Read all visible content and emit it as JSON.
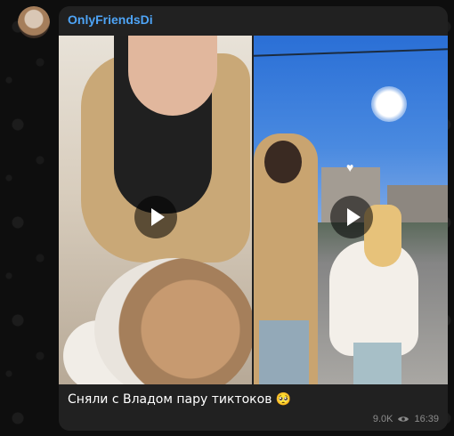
{
  "message": {
    "sender": "OnlyFriendsDi",
    "caption": "Сняли с Владом пару тиктоков 🥺",
    "views": "9.0K",
    "time": "16:39"
  },
  "media": [
    {
      "type": "video",
      "play_icon": "play-icon"
    },
    {
      "type": "video",
      "play_icon": "play-icon"
    }
  ],
  "colors": {
    "sender": "#4ea4f6",
    "bubble": "#212121",
    "background": "#0e0e0e"
  }
}
